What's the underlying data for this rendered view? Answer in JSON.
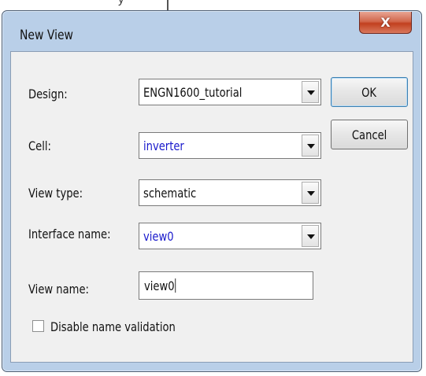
{
  "background": {
    "snippet": "y"
  },
  "window": {
    "title": "New View",
    "close_glyph": "X",
    "accent_close": "#c2401f"
  },
  "form": {
    "design": {
      "label": "Design:",
      "value": "ENGN1600_tutorial",
      "value_color": "#111111"
    },
    "cell": {
      "label": "Cell:",
      "value": "inverter",
      "value_color": "#1a1acc"
    },
    "view_type": {
      "label": "View type:",
      "value": "schematic",
      "value_color": "#111111"
    },
    "interface_name": {
      "label": "Interface name:",
      "value": "view0",
      "value_color": "#1a1acc"
    },
    "view_name": {
      "label": "View name:",
      "value": "view0"
    },
    "disable_validation": {
      "label": "Disable name validation",
      "checked": false
    }
  },
  "buttons": {
    "ok": "OK",
    "cancel": "Cancel"
  }
}
